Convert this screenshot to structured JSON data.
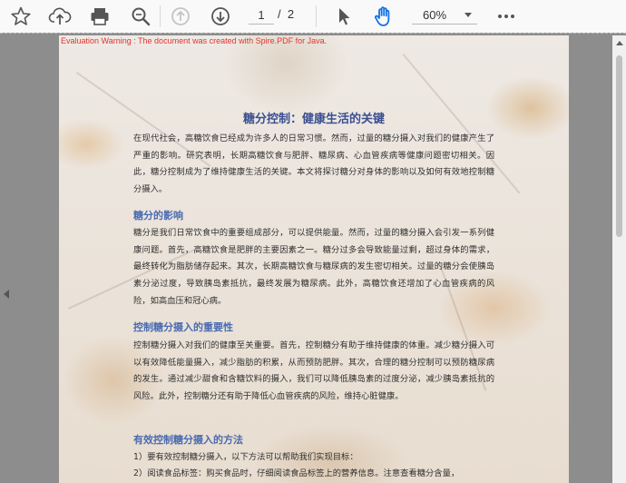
{
  "toolbar": {
    "page_current": "1",
    "page_separator": "/",
    "page_total": "2",
    "zoom": "60%"
  },
  "document": {
    "watermark": "Evaluation Warning : The document was created with Spire.PDF for Java.",
    "title": "糖分控制：健康生活的关键",
    "intro": "在现代社会，高糖饮食已经成为许多人的日常习惯。然而，过量的糖分摄入对我们的健康产生了严重的影响。研究表明，长期高糖饮食与肥胖、糖尿病、心血管疾病等健康问题密切相关。因此，糖分控制成为了维持健康生活的关键。本文将探讨糖分对身体的影响以及如何有效地控制糖分摄入。",
    "section1_heading": "糖分的影响",
    "section1_body": "糖分是我们日常饮食中的重要组成部分，可以提供能量。然而，过量的糖分摄入会引发一系列健康问题。首先，高糖饮食是肥胖的主要因素之一。糖分过多会导致能量过剩，超过身体的需求，最终转化为脂肪储存起来。其次，长期高糖饮食与糖尿病的发生密切相关。过量的糖分会使胰岛素分泌过度，导致胰岛素抵抗，最终发展为糖尿病。此外，高糖饮食还增加了心血管疾病的风险，如高血压和冠心病。",
    "section2_heading": "控制糖分摄入的重要性",
    "section2_body": "控制糖分摄入对我们的健康至关重要。首先，控制糖分有助于维持健康的体重。减少糖分摄入可以有效降低能量摄入，减少脂肪的积累，从而预防肥胖。其次，合理的糖分控制可以预防糖尿病的发生。通过减少甜食和含糖饮料的摄入，我们可以降低胰岛素的过度分泌，减少胰岛素抵抗的风险。此外，控制糖分还有助于降低心血管疾病的风险，维持心脏健康。",
    "section3_heading": "有效控制糖分摄入的方法",
    "section3_item1": "1）要有效控制糖分摄入，以下方法可以帮助我们实现目标：",
    "section3_item2": "2）阅读食品标签：购买食品时，仔细阅读食品标签上的营养信息。注意查看糖分含量，"
  }
}
